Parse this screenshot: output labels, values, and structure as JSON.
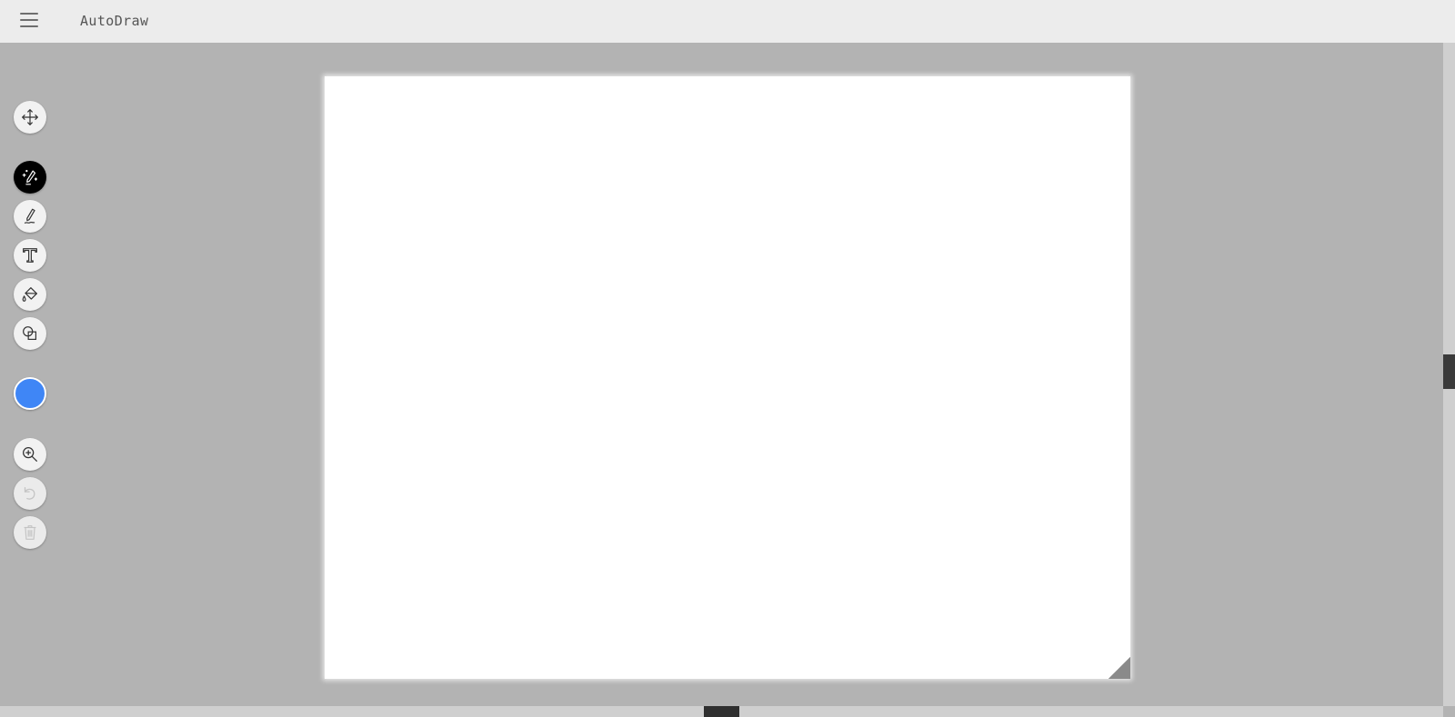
{
  "header": {
    "title": "AutoDraw",
    "menu_icon": "hamburger-menu-icon"
  },
  "toolbar": {
    "tools": [
      {
        "id": "move",
        "icon": "move-arrows-icon",
        "state": "normal"
      },
      {
        "id": "autodraw",
        "icon": "autodraw-pencil-sparkle-icon",
        "state": "active"
      },
      {
        "id": "draw",
        "icon": "pencil-icon",
        "state": "normal"
      },
      {
        "id": "type",
        "icon": "text-t-icon",
        "state": "normal"
      },
      {
        "id": "fill",
        "icon": "paint-bucket-icon",
        "state": "normal"
      },
      {
        "id": "shape",
        "icon": "shapes-icon",
        "state": "normal"
      },
      {
        "id": "color",
        "icon": "color-swatch-icon",
        "state": "normal",
        "color": "#3f86f6"
      },
      {
        "id": "zoom",
        "icon": "zoom-in-icon",
        "state": "normal"
      },
      {
        "id": "undo",
        "icon": "undo-icon",
        "state": "disabled"
      },
      {
        "id": "delete",
        "icon": "trash-icon",
        "state": "disabled"
      }
    ]
  },
  "colors": {
    "background": "#b3b3b3",
    "header": "#ececec",
    "canvas": "#ffffff",
    "selected_color": "#3f86f6",
    "active_tool": "#000000"
  }
}
